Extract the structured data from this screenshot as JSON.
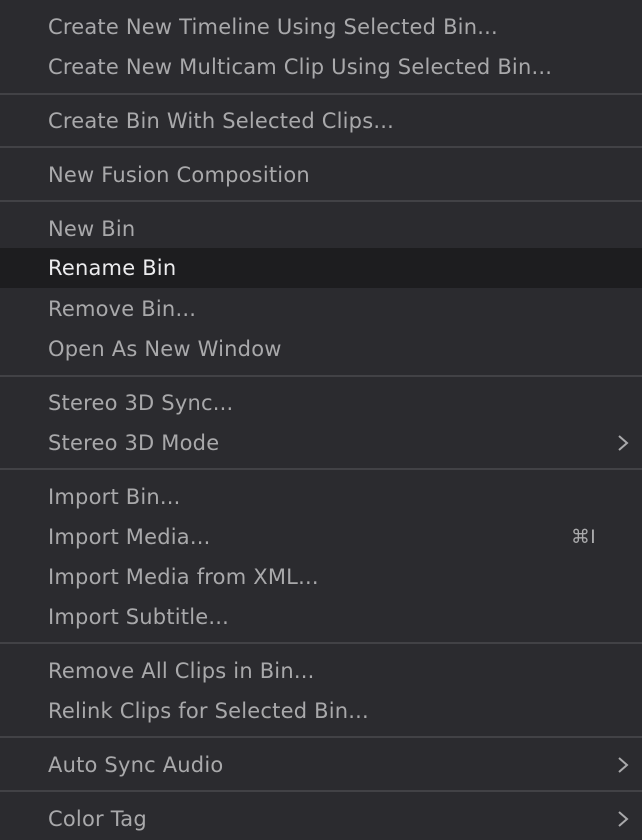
{
  "menu": {
    "items": [
      {
        "label": "Create New Timeline Using Selected Bin..."
      },
      {
        "label": "Create New Multicam Clip Using Selected Bin..."
      },
      {
        "label": "Create Bin With Selected Clips..."
      },
      {
        "label": "New Fusion Composition"
      },
      {
        "label": "New Bin"
      },
      {
        "label": "Rename Bin",
        "highlighted": true
      },
      {
        "label": "Remove Bin..."
      },
      {
        "label": "Open As New Window"
      },
      {
        "label": "Stereo 3D Sync..."
      },
      {
        "label": "Stereo 3D Mode",
        "submenu": true
      },
      {
        "label": "Import Bin..."
      },
      {
        "label": "Import Media...",
        "shortcut": "⌘I"
      },
      {
        "label": "Import Media from XML..."
      },
      {
        "label": "Import Subtitle..."
      },
      {
        "label": "Remove All Clips in Bin..."
      },
      {
        "label": "Relink Clips for Selected Bin..."
      },
      {
        "label": "Auto Sync Audio",
        "submenu": true
      },
      {
        "label": "Color Tag",
        "submenu": true
      }
    ],
    "submenu_icon": "chevron-right-icon",
    "colors": {
      "background": "#2b2b2f",
      "highlight_background": "#1d1d1f",
      "text": "#a9a9ab",
      "highlight_text": "#ececee",
      "separator": "#424246"
    }
  }
}
